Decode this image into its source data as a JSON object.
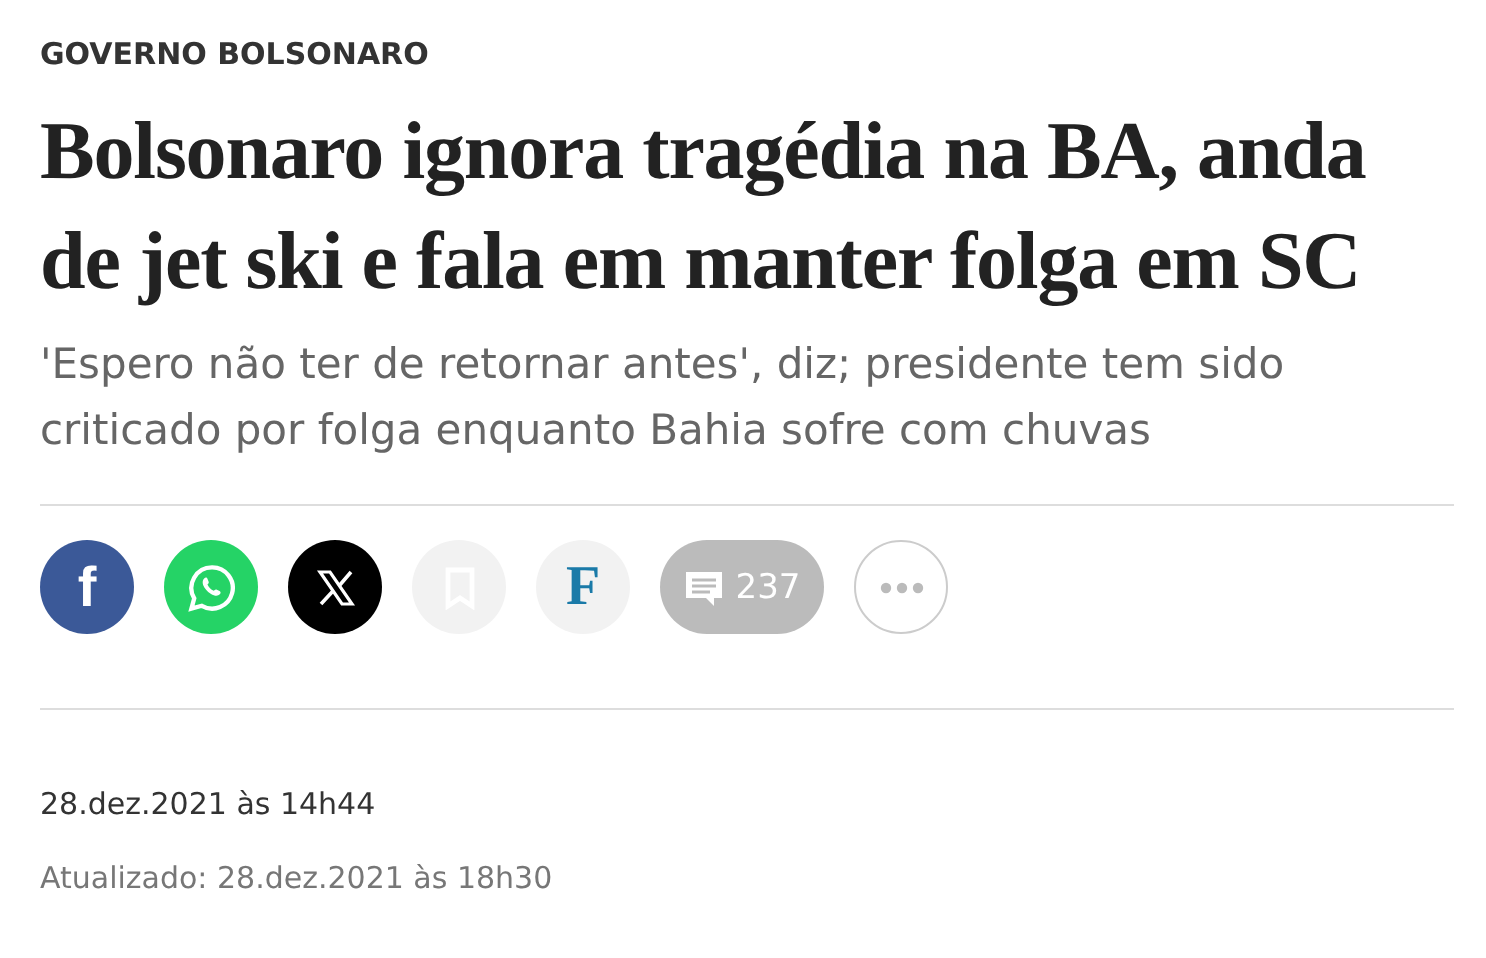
{
  "kicker": "GOVERNO BOLSONARO",
  "headline": "Bolsonaro ignora tragédia na BA, anda de jet ski e fala em manter folga em SC",
  "subtitle": "'Espero não ter de retornar antes', diz; presidente tem sido criticado por folga enquanto Bahia sofre com chuvas",
  "share_buttons": [
    {
      "kind": "facebook",
      "label": "f"
    },
    {
      "kind": "whatsapp"
    },
    {
      "kind": "x"
    },
    {
      "kind": "bookmark"
    },
    {
      "kind": "logo",
      "label": "F"
    },
    {
      "kind": "comments",
      "count": "237"
    },
    {
      "kind": "more"
    }
  ],
  "published": "28.dez.2021 às 14h44",
  "updated": "Atualizado: 28.dez.2021 às 18h30"
}
